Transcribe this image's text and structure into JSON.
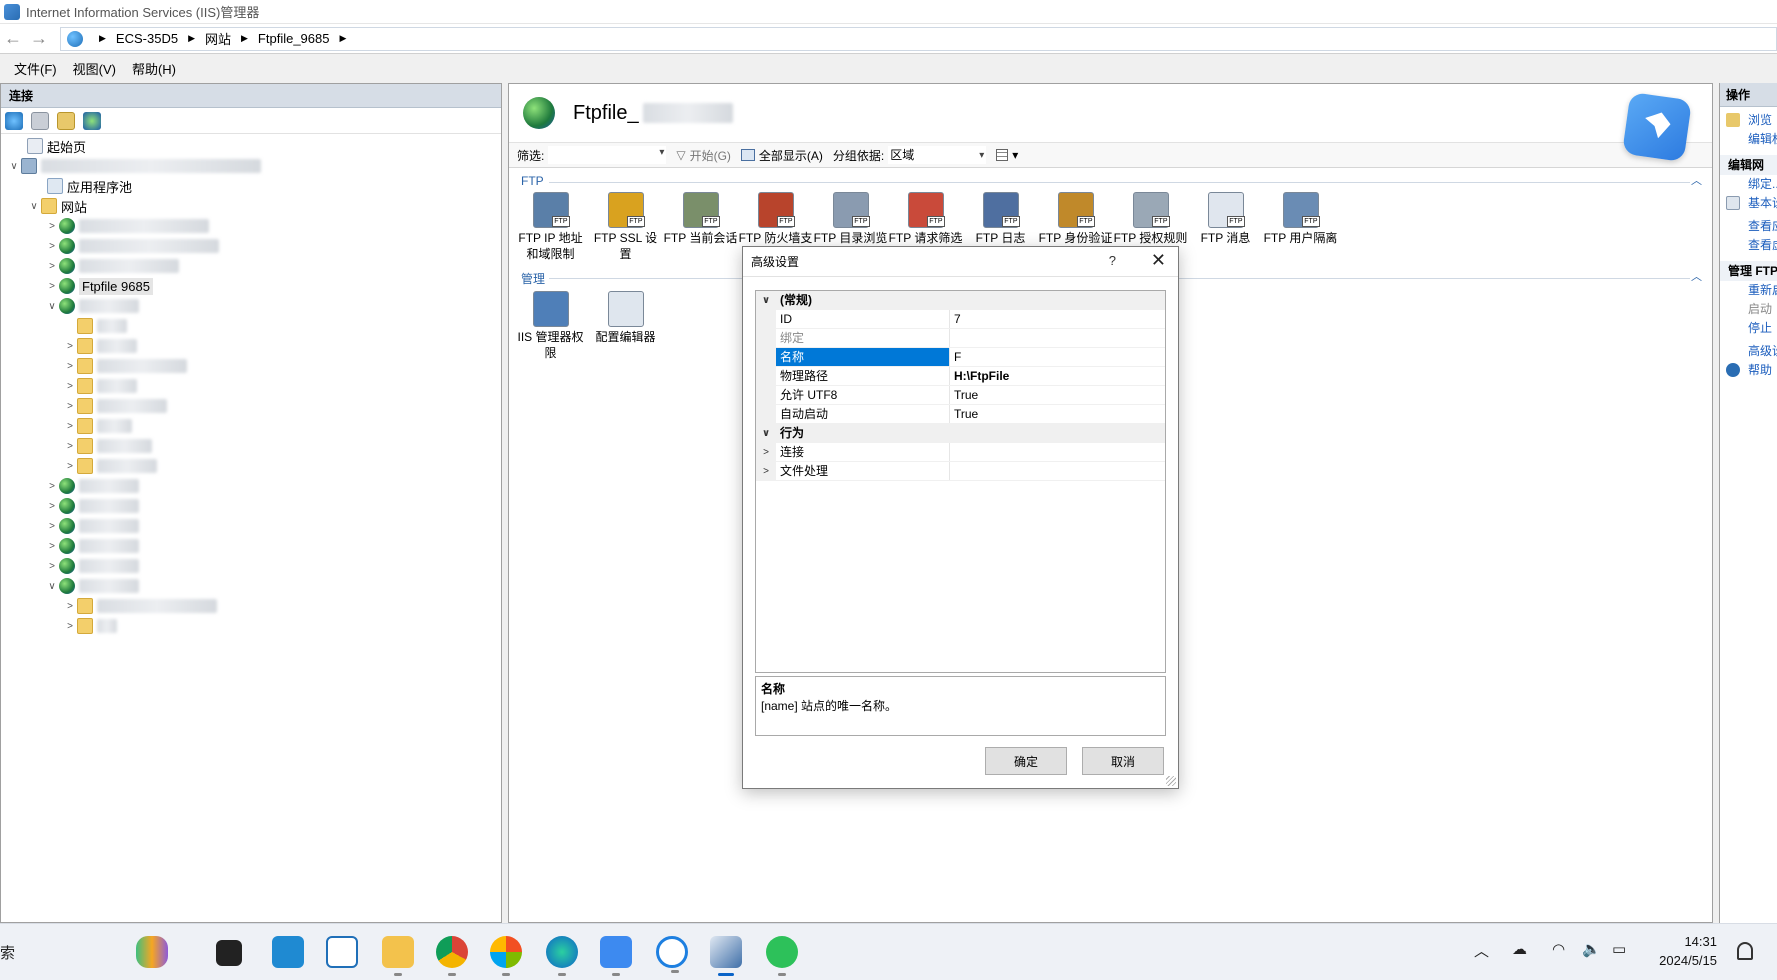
{
  "window": {
    "title": "Internet Information Services (IIS)管理器"
  },
  "address": {
    "crumbs": [
      "ECS-35D5",
      "网站",
      "Ftpfile_9685"
    ]
  },
  "menu": [
    "文件(F)",
    "视图(V)",
    "帮助(H)"
  ],
  "connections": {
    "header": "连接",
    "start_page": "起始页",
    "app_pools": "应用程序池",
    "sites": "网站",
    "selected_site": "Ftpfile 9685"
  },
  "page": {
    "title": "Ftpfile_",
    "filter_label": "筛选:",
    "start_label": "开始(G)",
    "show_all_label": "全部显示(A)",
    "group_by_label": "分组依据:",
    "group_by_value": "区域",
    "sections": [
      {
        "name": "FTP",
        "features": [
          {
            "label": "FTP IP 地址和域限制",
            "icon": "ftp-ip-restriction-icon",
            "color": "#5a7fa8"
          },
          {
            "label": "FTP SSL 设置",
            "icon": "ftp-ssl-lock-icon",
            "color": "#d9a21f"
          },
          {
            "label": "FTP 当前会话",
            "icon": "ftp-sessions-icon",
            "color": "#7a8f6a"
          },
          {
            "label": "FTP 防火墙支持",
            "icon": "ftp-firewall-icon",
            "color": "#b8442c"
          },
          {
            "label": "FTP 目录浏览",
            "icon": "ftp-directory-browse-icon",
            "color": "#8a9bb0"
          },
          {
            "label": "FTP 请求筛选",
            "icon": "ftp-request-filter-icon",
            "color": "#c94a3a"
          },
          {
            "label": "FTP 日志",
            "icon": "ftp-log-icon",
            "color": "#4f6fa0"
          },
          {
            "label": "FTP 身份验证",
            "icon": "ftp-auth-icon",
            "color": "#c0892a"
          },
          {
            "label": "FTP 授权规则",
            "icon": "ftp-authz-icon",
            "color": "#9aa8b6"
          },
          {
            "label": "FTP 消息",
            "icon": "ftp-message-icon",
            "color": "#e0e6ee"
          },
          {
            "label": "FTP 用户隔离",
            "icon": "ftp-user-isolation-icon",
            "color": "#6a8cb4"
          }
        ]
      },
      {
        "name": "管理",
        "features": [
          {
            "label": "IIS 管理器权限",
            "icon": "iis-manager-permissions-icon",
            "color": "#4f7fb8"
          },
          {
            "label": "配置编辑器",
            "icon": "config-editor-icon",
            "color": "#dfe6ee"
          }
        ]
      }
    ]
  },
  "actions": {
    "header": "操作",
    "items": [
      {
        "label": "浏览",
        "gray": false
      },
      {
        "label": "编辑权",
        "gray": false
      }
    ],
    "group1": "编辑网",
    "items2": [
      {
        "label": "绑定...",
        "gray": false
      },
      {
        "label": "基本设",
        "gray": false
      },
      {
        "label": "查看应",
        "gray": false
      },
      {
        "label": "查看虚",
        "gray": false
      }
    ],
    "group2": "管理 FTP",
    "items3": [
      {
        "label": "重新启",
        "gray": false
      },
      {
        "label": "启动",
        "gray": true
      },
      {
        "label": "停止",
        "gray": false
      },
      {
        "label": "高级设",
        "gray": false
      },
      {
        "label": "帮助",
        "gray": false
      }
    ]
  },
  "dialog": {
    "title": "高级设置",
    "help": "?",
    "rows": [
      {
        "type": "cat",
        "toggle": "∨",
        "name": "(常规)",
        "value": ""
      },
      {
        "type": "prop",
        "name": "ID",
        "value": "7"
      },
      {
        "type": "prop",
        "name": "绑定",
        "value": "",
        "dim": true
      },
      {
        "type": "prop",
        "name": "名称",
        "value": "F",
        "selected": true
      },
      {
        "type": "prop",
        "name": "物理路径",
        "value": "H:\\FtpFile",
        "bold": true
      },
      {
        "type": "prop",
        "name": "允许 UTF8",
        "value": "True"
      },
      {
        "type": "prop",
        "name": "自动启动",
        "value": "True"
      },
      {
        "type": "cat",
        "toggle": "∨",
        "name": "行为",
        "value": ""
      },
      {
        "type": "sub",
        "toggle": ">",
        "name": "连接",
        "value": ""
      },
      {
        "type": "sub",
        "toggle": ">",
        "name": "文件处理",
        "value": ""
      }
    ],
    "description": {
      "name": "名称",
      "text": "[name] 站点的唯一名称。"
    },
    "ok": "确定",
    "cancel": "取消"
  },
  "taskbar": {
    "search": "索",
    "clock_time": "14:31",
    "clock_date": "2024/5/15"
  }
}
